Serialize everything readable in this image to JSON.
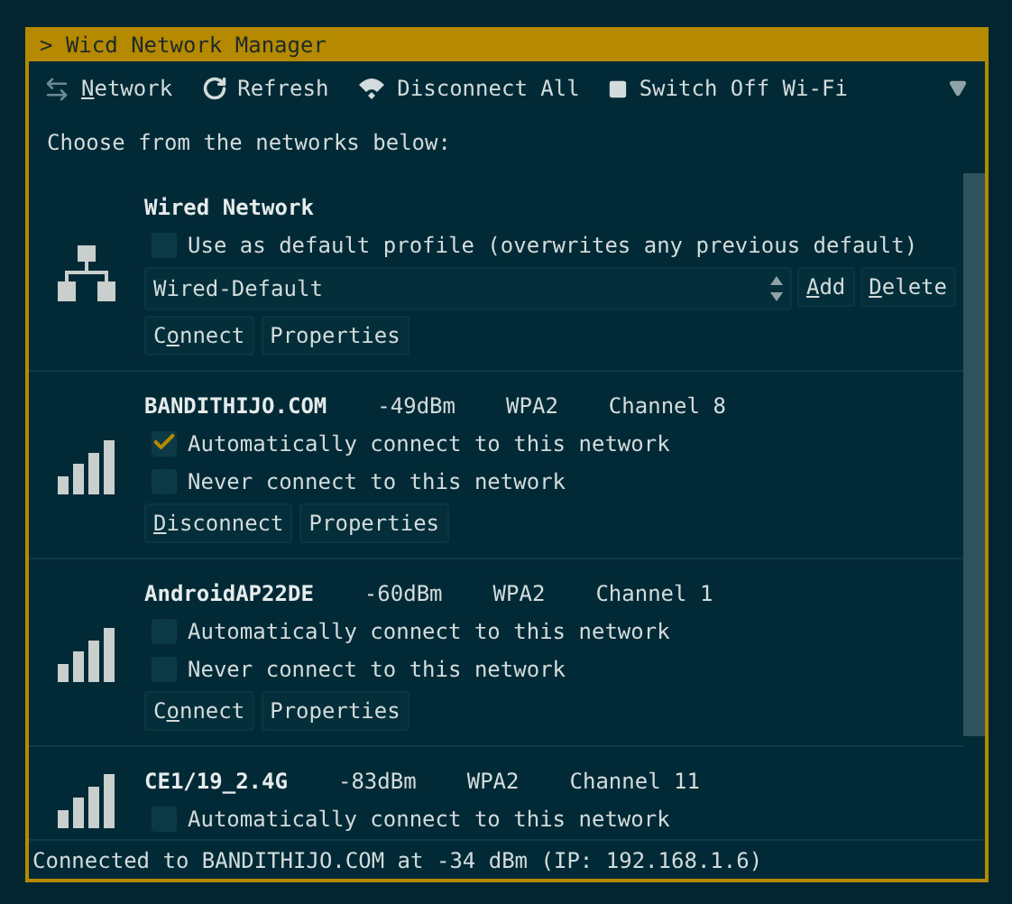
{
  "window": {
    "title": "> Wicd Network Manager"
  },
  "toolbar": [
    {
      "kind": "network",
      "label": {
        "key": "N",
        "after": "etwork"
      }
    },
    {
      "kind": "refresh",
      "label": {
        "before": "Refresh"
      }
    },
    {
      "kind": "disconnect",
      "label": {
        "before": "Disconnect All"
      }
    },
    {
      "kind": "switch",
      "label": {
        "before": "Switch Off Wi-Fi"
      }
    }
  ],
  "prompt": "Choose from the networks below:",
  "networks": [
    {
      "kind": "wired",
      "title": "Wired Network",
      "options": [
        {
          "label": "Use as default profile (overwrites any previous default)",
          "checked": false
        }
      ],
      "profile": {
        "value": "Wired-Default",
        "buttons": [
          {
            "key": "A",
            "after": "dd"
          },
          {
            "key": "D",
            "after": "elete"
          }
        ]
      },
      "buttons": [
        {
          "before": "C",
          "key": "o",
          "after": "nnect"
        },
        {
          "before": "Properties"
        }
      ]
    },
    {
      "kind": "wireless",
      "title": "BANDITHIJO.COM",
      "strength": "-49dBm",
      "security": "WPA2",
      "channel": "Channel 8",
      "options": [
        {
          "label": "Automatically connect to this network",
          "checked": true
        },
        {
          "label": "Never connect to this network",
          "checked": false
        }
      ],
      "buttons": [
        {
          "key": "D",
          "after": "isconnect"
        },
        {
          "before": "Properties"
        }
      ]
    },
    {
      "kind": "wireless",
      "title": "AndroidAP22DE",
      "strength": "-60dBm",
      "security": "WPA2",
      "channel": "Channel 1",
      "options": [
        {
          "label": "Automatically connect to this network",
          "checked": false
        },
        {
          "label": "Never connect to this network",
          "checked": false
        }
      ],
      "buttons": [
        {
          "before": "C",
          "key": "o",
          "after": "nnect"
        },
        {
          "before": "Properties"
        }
      ]
    },
    {
      "kind": "wireless",
      "title": "CE1/19_2.4G",
      "strength": "-83dBm",
      "security": "WPA2",
      "channel": "Channel 11",
      "options": [
        {
          "label": "Automatically connect to this network",
          "checked": false
        }
      ]
    }
  ],
  "status_bar": "Connected to BANDITHIJO.COM at -34 dBm (IP: 192.168.1.6)"
}
